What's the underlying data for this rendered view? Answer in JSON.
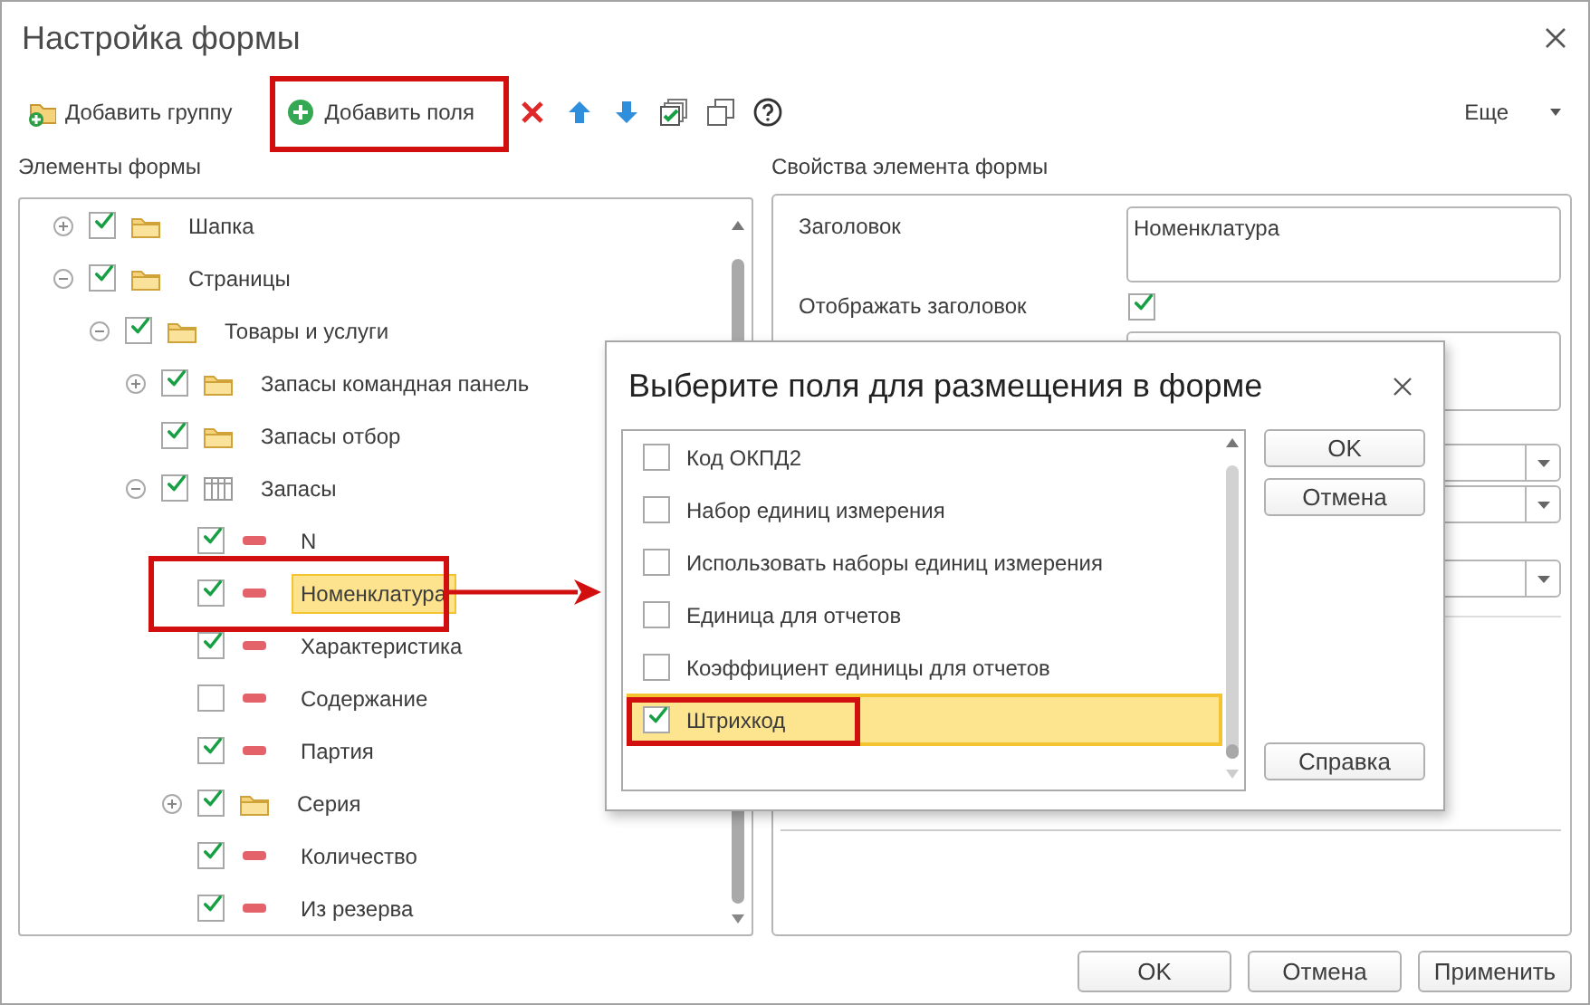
{
  "window": {
    "title": "Настройка формы"
  },
  "toolbar": [
    {
      "kind": "add-group",
      "label": "Добавить группу"
    },
    {
      "kind": "add-fields",
      "label": "Добавить поля"
    },
    {
      "kind": "delete"
    },
    {
      "kind": "up"
    },
    {
      "kind": "down"
    },
    {
      "kind": "check-all"
    },
    {
      "kind": "uncheck-all"
    },
    {
      "kind": "help"
    }
  ],
  "more_menu": {
    "label": "Еще"
  },
  "elements_panel": {
    "title": "Элементы формы",
    "tree": [
      {
        "label": "Шапка",
        "kind": "folder",
        "checked": true,
        "expanded": false,
        "selected": false
      },
      {
        "label": "Страницы",
        "kind": "folder",
        "checked": true,
        "expanded": true,
        "selected": false,
        "children": [
          {
            "label": "Товары и услуги",
            "kind": "folder",
            "checked": true,
            "expanded": true,
            "selected": false,
            "children": [
              {
                "label": "Запасы командная панель",
                "kind": "folder",
                "checked": true,
                "expanded": false,
                "selected": false
              },
              {
                "label": "Запасы отбор",
                "kind": "folder",
                "checked": true,
                "selected": false
              },
              {
                "label": "Запасы",
                "kind": "table",
                "checked": true,
                "expanded": true,
                "selected": false,
                "children": [
                  {
                    "label": "N",
                    "kind": "field",
                    "checked": true,
                    "selected": false
                  },
                  {
                    "label": "Номенклатура",
                    "kind": "field",
                    "checked": true,
                    "selected": true
                  },
                  {
                    "label": "Характеристика",
                    "kind": "field",
                    "checked": true,
                    "selected": false
                  },
                  {
                    "label": "Содержание",
                    "kind": "field",
                    "checked": false,
                    "selected": false
                  },
                  {
                    "label": "Партия",
                    "kind": "field",
                    "checked": true,
                    "selected": false
                  },
                  {
                    "label": "Серия",
                    "kind": "folder",
                    "checked": true,
                    "expanded": false,
                    "selected": false
                  },
                  {
                    "label": "Количество",
                    "kind": "field",
                    "checked": true,
                    "selected": false
                  },
                  {
                    "label": "Из резерва",
                    "kind": "field",
                    "checked": true,
                    "selected": false
                  }
                ]
              }
            ]
          }
        ]
      }
    ]
  },
  "properties_panel": {
    "title": "Свойства элемента формы",
    "properties": [
      {
        "kind": "text",
        "label": "Заголовок",
        "value": "Номенклатура"
      },
      {
        "kind": "checkbox",
        "label": "Отображать заголовок",
        "checked": true
      },
      {
        "kind": "textarea"
      },
      {
        "kind": "dropdown"
      },
      {
        "kind": "dropdown"
      },
      {
        "kind": "dropdown"
      }
    ]
  },
  "buttons": [
    {
      "label": "OK"
    },
    {
      "label": "Отмена"
    },
    {
      "label": "Применить"
    }
  ],
  "dialog": {
    "title": "Выберите поля для размещения в форме",
    "fields": [
      {
        "label": "Код ОКПД2",
        "checked": false,
        "selected": false
      },
      {
        "label": "Набор единиц измерения",
        "checked": false,
        "selected": false
      },
      {
        "label": "Использовать наборы единиц измерения",
        "checked": false,
        "selected": false
      },
      {
        "label": "Единица для отчетов",
        "checked": false,
        "selected": false
      },
      {
        "label": "Коэффициент единицы для отчетов",
        "checked": false,
        "selected": false
      },
      {
        "label": "Штрихкод",
        "checked": true,
        "selected": true
      }
    ],
    "buttons": [
      {
        "label": "OK",
        "kind": "top"
      },
      {
        "label": "Отмена",
        "kind": "top"
      },
      {
        "label": "Справка",
        "kind": "bottom"
      }
    ]
  }
}
